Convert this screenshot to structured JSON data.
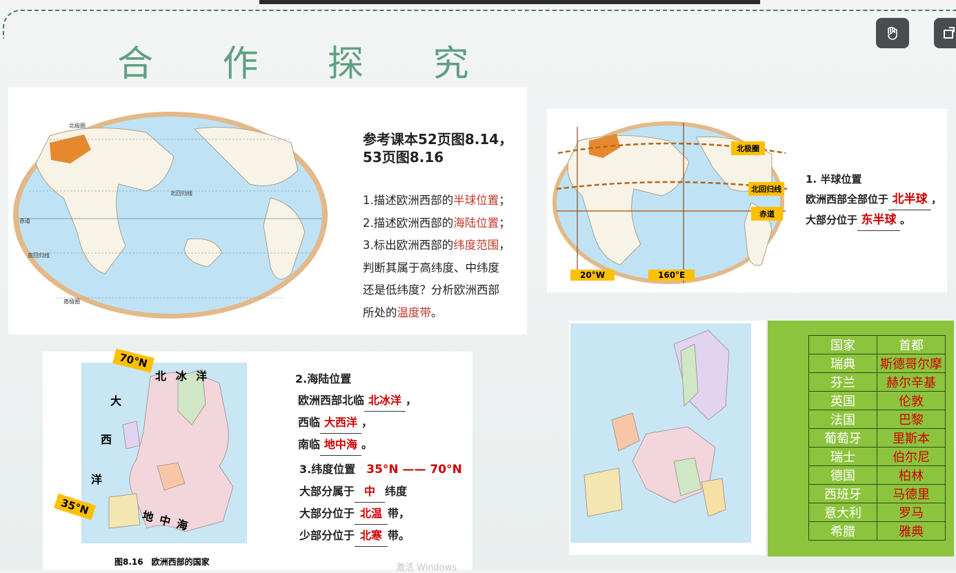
{
  "title": "合 作 探 究",
  "panel1": {
    "ref_line1": "参考课本52页图8.14，",
    "ref_line2": "53页图8.16",
    "q1_pre": "1.描述欧洲西部的",
    "q1_hl": "半球位置",
    "q1_post": "；",
    "q2_pre": "2.描述欧洲西部的",
    "q2_hl": "海陆位置",
    "q2_post": "；",
    "q3_pre": "3.标出欧洲西部的",
    "q3_hl": "纬度范围",
    "q3_post": "，",
    "q3_l2": "判断其属于高纬度、中纬度",
    "q3_l3": "还是低纬度？分析欧洲西部",
    "q3_l4_pre": "所处的",
    "q3_l4_hl": "温度带",
    "q3_l4_post": "。",
    "map_labels": {
      "arctic": "北极圈",
      "tropic_n": "北回归线",
      "equator": "赤道",
      "tropic_s": "南回归线",
      "antarctic": "南极圈"
    }
  },
  "panel2": {
    "tags": {
      "arctic": "北极圈",
      "tropic": "北回归线",
      "equator": "赤道",
      "w20": "20°W",
      "e160": "160°E"
    },
    "heading": "1. 半球位置",
    "l1_pre": "欧洲西部全部位于",
    "l1_ans": "北半球",
    "l1_post": "，",
    "l2_pre": "大部分位于",
    "l2_ans": "东半球",
    "l2_post": "。"
  },
  "panel3": {
    "lat70": "70°N",
    "lat35": "35°N",
    "ocean_north": "北 冰 洋",
    "ocean_west": [
      "大",
      "西",
      "洋"
    ],
    "sea_south": "地 中 海",
    "caption": "图8.16　欧洲西部的国家",
    "h2": "2.海陆位置",
    "n_pre": "欧洲西部北临",
    "n_ans": "北冰洋",
    "n_post": "，",
    "w_pre": "西临",
    "w_ans": "大西洋",
    "w_post": "，",
    "s_pre": "南临",
    "s_ans": "地中海",
    "s_post": "。",
    "h3": "3.纬度位置",
    "lat_range": "35°N —— 70°N",
    "a_pre": "大部分属于",
    "a_ans": "中",
    "a_post": "纬度",
    "b_pre": "大部分位于",
    "b_ans": "北温",
    "b_post": "带，",
    "c_pre": "少部分位于",
    "c_ans": "北寒",
    "c_post": "带。",
    "watermark": "激活 Windows"
  },
  "table": {
    "headers": [
      "国家",
      "首都"
    ],
    "rows": [
      [
        "瑞典",
        "斯德哥尔摩"
      ],
      [
        "芬兰",
        "赫尔辛基"
      ],
      [
        "英国",
        "伦敦"
      ],
      [
        "法国",
        "巴黎"
      ],
      [
        "葡萄牙",
        "里斯本"
      ],
      [
        "瑞士",
        "伯尔尼"
      ],
      [
        "德国",
        "柏林"
      ],
      [
        "西班牙",
        "马德里"
      ],
      [
        "意大利",
        "罗马"
      ],
      [
        "希腊",
        "雅典"
      ]
    ]
  },
  "colors": {
    "accent_green": "#5f9f84",
    "answer_red": "#d00000",
    "table_bg": "#8cc43d",
    "tag_yellow": "#ffc000"
  }
}
